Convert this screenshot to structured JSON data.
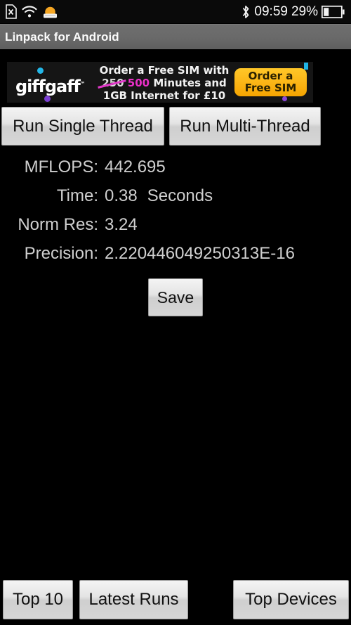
{
  "statusbar": {
    "left_icons": [
      {
        "name": "sim-card-missing-icon",
        "glyph": "sd-x"
      },
      {
        "name": "wifi-icon",
        "glyph": "wifi"
      },
      {
        "name": "notification-icon",
        "glyph": "sunrise"
      }
    ],
    "bluetooth_icon": "bluetooth-icon",
    "time": "09:59",
    "battery_percent": "29%",
    "battery_icon": "battery-icon",
    "battery_level": 29
  },
  "titlebar": {
    "title": "Linpack for Android"
  },
  "ad": {
    "name": "giffgaff-ad-banner",
    "logo": "giffgaff",
    "logo_mark": "™",
    "line1": "Order a Free SIM with",
    "line2_strike": "250",
    "line2_highlight": "500",
    "line2_rest": "Minutes and",
    "line3": "1GB Internet for £10",
    "cta_line1": "Order a",
    "cta_line2": "Free SIM",
    "cta_color": "#fbb415",
    "highlight_color": "#ea2fc7"
  },
  "actions": {
    "run_single_thread": "Run Single Thread",
    "run_multi_thread": "Run Multi-Thread",
    "save": "Save"
  },
  "results": [
    {
      "label": "MFLOPS:",
      "value": "442.695",
      "unit": ""
    },
    {
      "label": "Time:",
      "value": "0.38",
      "unit": "Seconds"
    },
    {
      "label": "Norm Res:",
      "value": "3.24",
      "unit": ""
    },
    {
      "label": "Precision:",
      "value": "2.220446049250313E-16",
      "unit": ""
    }
  ],
  "bottom_bar": {
    "top10": "Top 10",
    "latest_runs": "Latest Runs",
    "top_devices": "Top Devices"
  }
}
